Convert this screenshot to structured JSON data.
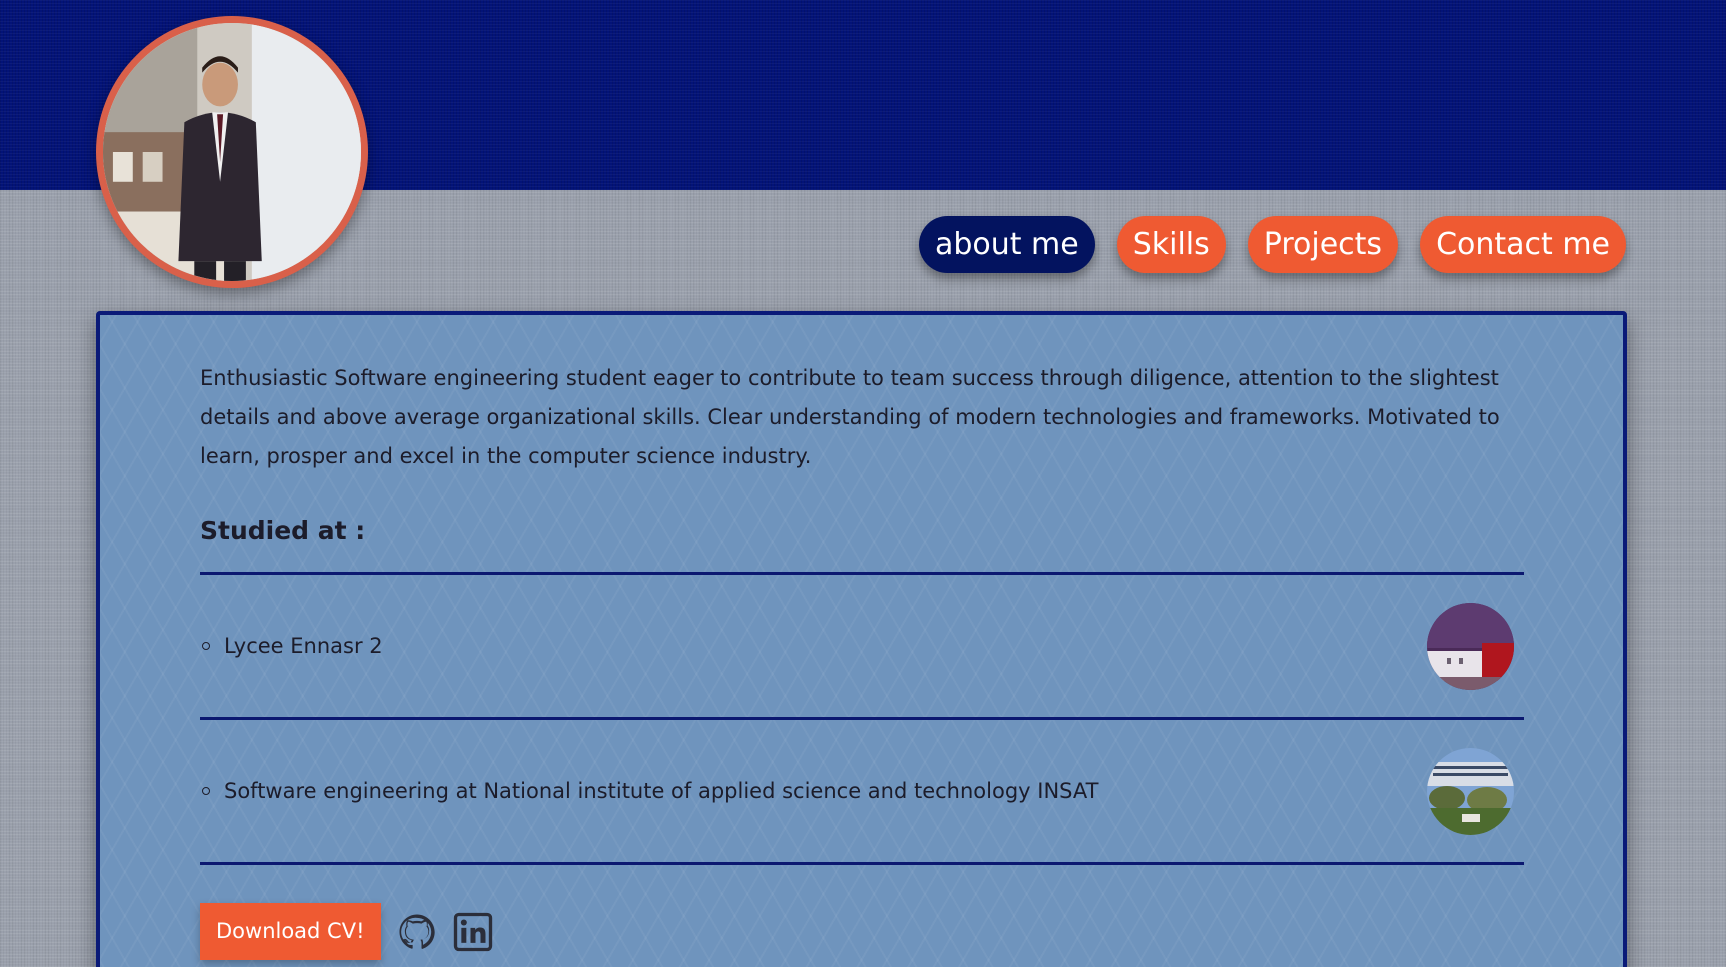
{
  "header": {
    "avatar_icon": "profile-photo",
    "accent_color": "#ef5a32",
    "header_color": "#031378"
  },
  "nav": {
    "items": [
      {
        "label": "about me",
        "active": true
      },
      {
        "label": "Skills",
        "active": false
      },
      {
        "label": "Projects",
        "active": false
      },
      {
        "label": "Contact me",
        "active": false
      }
    ]
  },
  "about": {
    "bio": "Enthusiastic Software engineering student eager to contribute to team success through diligence, attention to the slightest details and above average organizational skills. Clear understanding of modern technologies and frameworks. Motivated to learn, prosper and excel in the computer science industry.",
    "studied_heading": "Studied at :",
    "schools": [
      {
        "name": "Lycee Ennasr 2",
        "image_icon": "school-photo"
      },
      {
        "name": "Software engineering at National institute of applied science and technology INSAT",
        "image_icon": "university-photo"
      }
    ],
    "cv_button": "Download CV!",
    "social_icons": [
      "github-icon",
      "linkedin-icon"
    ]
  }
}
